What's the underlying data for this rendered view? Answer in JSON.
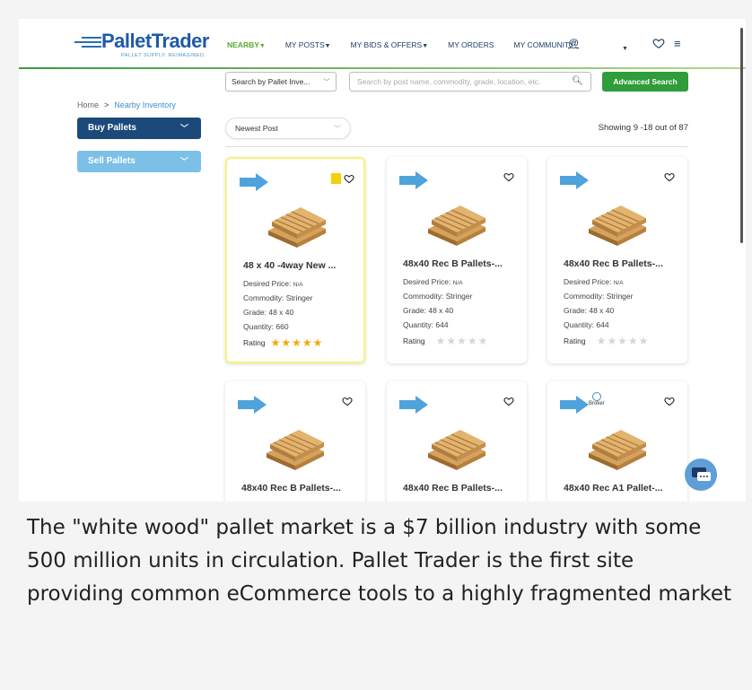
{
  "logo": {
    "name": "PalletTrader",
    "tagline": "PALLET SUPPLY. REIMAGINED."
  },
  "nav": [
    {
      "label": "NEARBY",
      "caret": true,
      "active": true
    },
    {
      "label": "MY POSTS",
      "caret": true,
      "active": false
    },
    {
      "label": "MY BIDS & OFFERS",
      "caret": true,
      "active": false
    },
    {
      "label": "MY ORDERS",
      "caret": false,
      "active": false
    },
    {
      "label": "MY COMMUNITY",
      "caret": false,
      "active": false
    }
  ],
  "search": {
    "category_value": "Search by Pallet Inve...",
    "placeholder": "Search by post name, commodity, grade, location, etc.",
    "advanced_label": "Advanced Search"
  },
  "breadcrumb": {
    "home": "Home",
    "separator": ">",
    "current": "Nearby Inventory"
  },
  "sidebar": {
    "buy_label": "Buy Pallets",
    "sell_label": "Sell Pallets"
  },
  "sort": {
    "value": "Newest Post"
  },
  "showing": "Showing 9 -18 out of 87",
  "labels": {
    "desired_price": "Desired Price:",
    "price_value": "N/A",
    "rating": "Rating"
  },
  "cards": [
    {
      "title": "48 x 40 -4way New ...",
      "commodity": "Commodity: Stringer",
      "grade": "Grade: 48 x 40",
      "quantity": "Quantity: 660",
      "stars_on": "★★★★★",
      "stars_off": "",
      "highlighted": true,
      "bookmarked": true,
      "broker": false
    },
    {
      "title": "48x40 Rec B Pallets-...",
      "commodity": "Commodity: Stringer",
      "grade": "Grade: 48 x 40",
      "quantity": "Quantity: 644",
      "stars_on": "",
      "stars_off": "★★★★★",
      "highlighted": false,
      "bookmarked": false,
      "broker": false
    },
    {
      "title": "48x40 Rec B Pallets-...",
      "commodity": "Commodity: Stringer",
      "grade": "Grade: 48 x 40",
      "quantity": "Quantity: 644",
      "stars_on": "",
      "stars_off": "★★★★★",
      "highlighted": false,
      "bookmarked": false,
      "broker": false
    },
    {
      "title": "48x40 Rec B Pallets-...",
      "highlighted": false,
      "bookmarked": false,
      "broker": false
    },
    {
      "title": "48x40 Rec B Pallets-...",
      "highlighted": false,
      "bookmarked": false,
      "broker": false
    },
    {
      "title": "48x40 Rec A1 Pallet-...",
      "highlighted": false,
      "bookmarked": false,
      "broker": true,
      "broker_label": "Broker"
    }
  ],
  "caption": "The \"white wood\" pallet market is a $7 billion industry with some 500 million units in circulation. Pallet Trader is the first site providing common eCommerce tools to a highly fragmented market",
  "colors": {
    "brand_blue": "#1e5aa8",
    "nav_active": "#5aab2e",
    "button_green": "#2e9d3a",
    "buy_blue": "#1b4a7a",
    "sell_blue": "#7cc0e8",
    "star": "#f5a800"
  }
}
